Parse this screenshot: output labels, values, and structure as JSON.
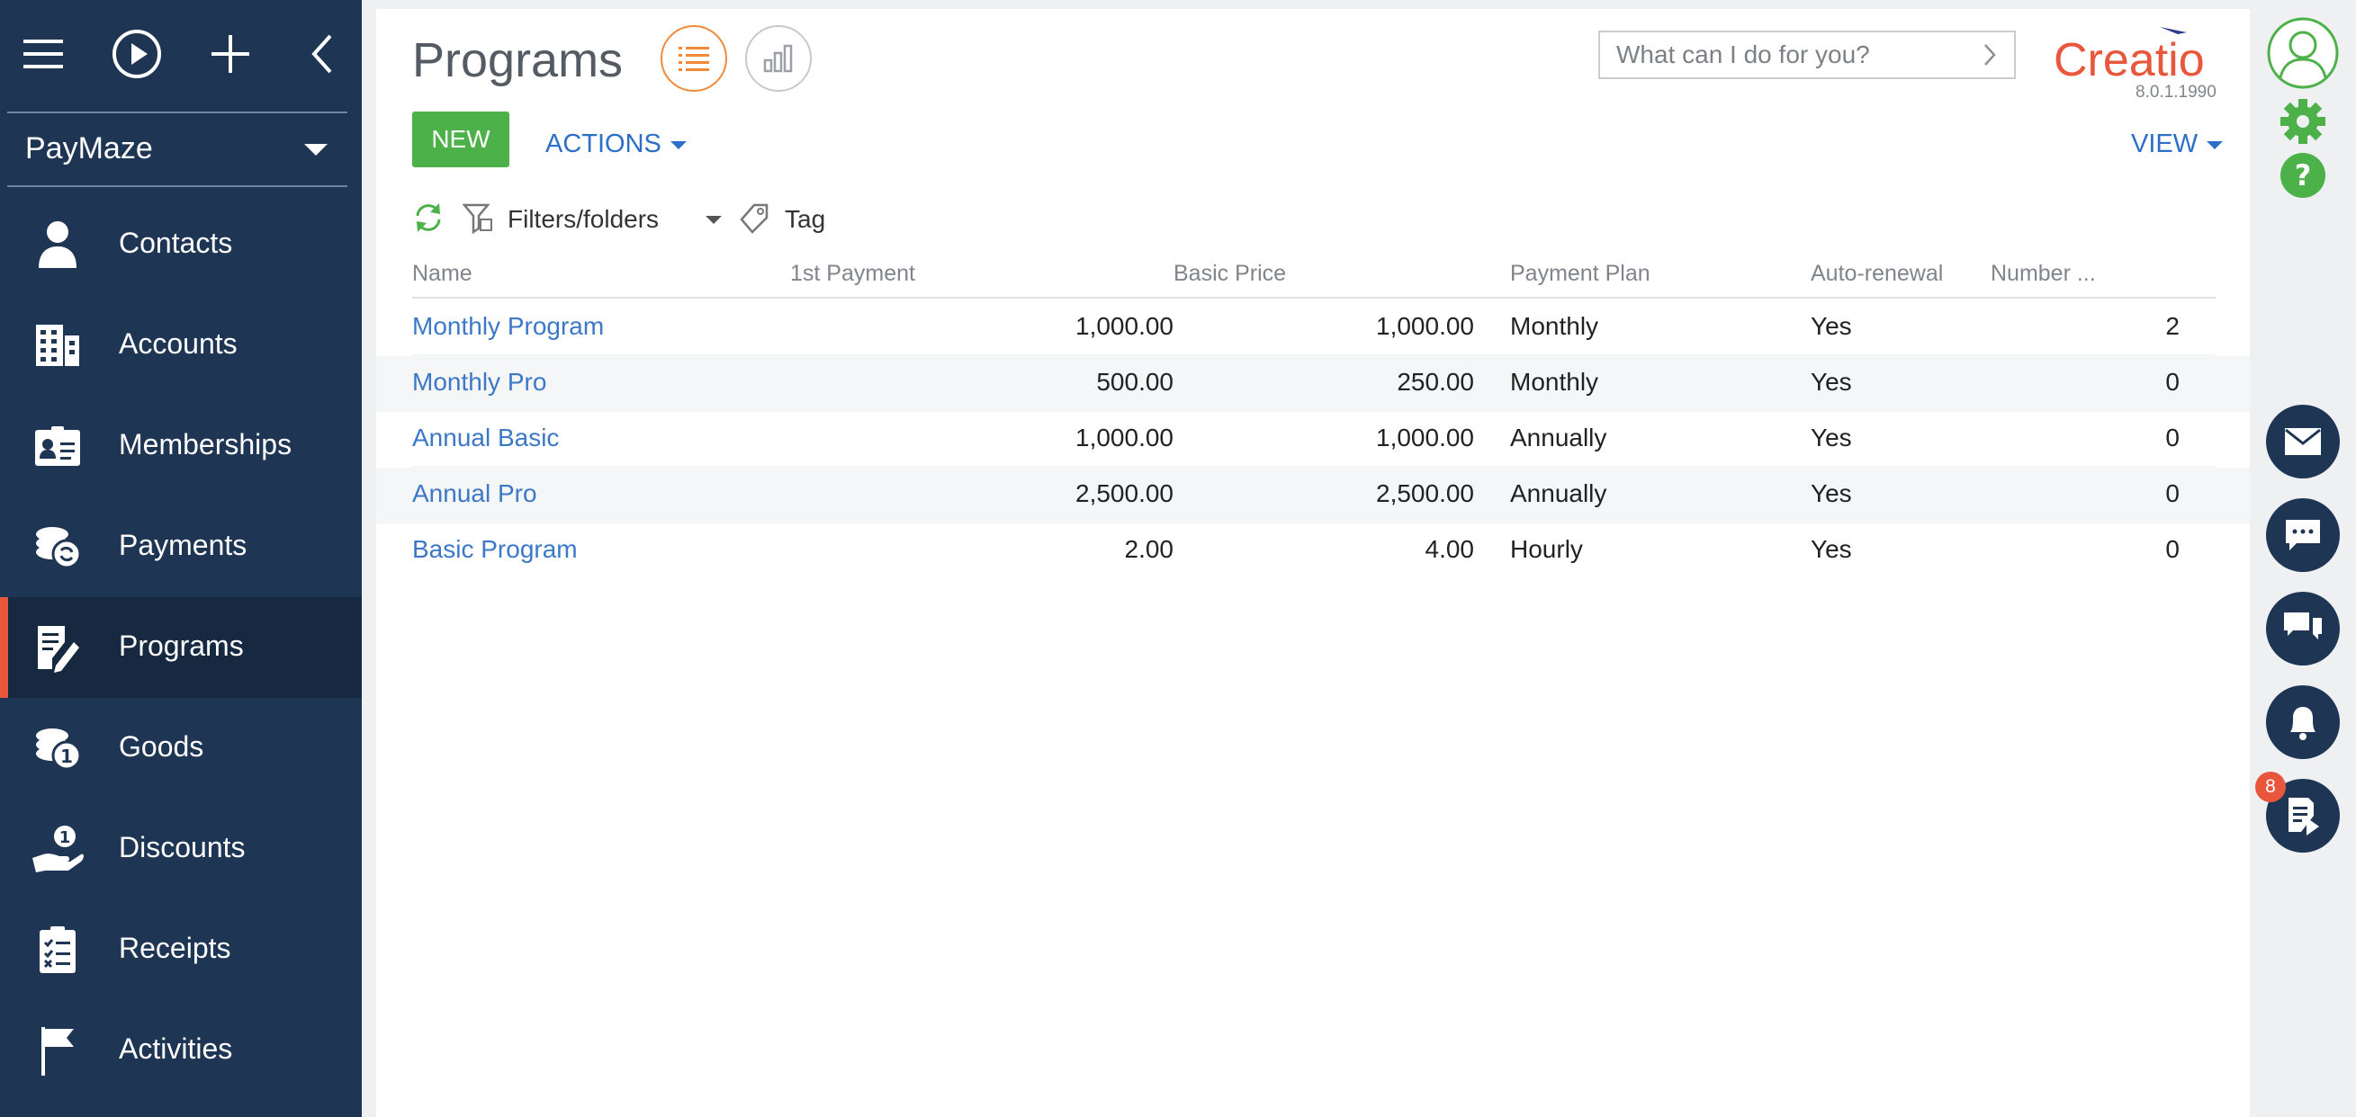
{
  "sidebar": {
    "workspace": "PayMaze",
    "items": [
      {
        "label": "Contacts",
        "icon": "person-icon"
      },
      {
        "label": "Accounts",
        "icon": "building-icon"
      },
      {
        "label": "Memberships",
        "icon": "id-card-icon"
      },
      {
        "label": "Payments",
        "icon": "coins-icon"
      },
      {
        "label": "Programs",
        "icon": "edit-document-icon",
        "active": true
      },
      {
        "label": "Goods",
        "icon": "coins-one-icon"
      },
      {
        "label": "Discounts",
        "icon": "hand-coin-icon"
      },
      {
        "label": "Receipts",
        "icon": "checklist-icon"
      },
      {
        "label": "Activities",
        "icon": "flag-icon"
      }
    ]
  },
  "header": {
    "title": "Programs",
    "search_placeholder": "What can I do for you?",
    "logo_text": "Creatio",
    "version": "8.0.1.1990"
  },
  "toolbar": {
    "new_label": "NEW",
    "actions_label": "ACTIONS",
    "view_label": "VIEW"
  },
  "filters": {
    "filters_label": "Filters/folders",
    "tag_label": "Tag"
  },
  "table": {
    "columns": [
      "Name",
      "1st Payment",
      "Basic Price",
      "Payment Plan",
      "Auto-renewal",
      "Number ..."
    ],
    "rows": [
      {
        "name": "Monthly Program",
        "first_payment": "1,000.00",
        "basic_price": "1,000.00",
        "plan": "Monthly",
        "auto_renewal": "Yes",
        "number": "2"
      },
      {
        "name": "Monthly Pro",
        "first_payment": "500.00",
        "basic_price": "250.00",
        "plan": "Monthly",
        "auto_renewal": "Yes",
        "number": "0"
      },
      {
        "name": "Annual Basic",
        "first_payment": "1,000.00",
        "basic_price": "1,000.00",
        "plan": "Annually",
        "auto_renewal": "Yes",
        "number": "0"
      },
      {
        "name": "Annual Pro",
        "first_payment": "2,500.00",
        "basic_price": "2,500.00",
        "plan": "Annually",
        "auto_renewal": "Yes",
        "number": "0"
      },
      {
        "name": "Basic Program",
        "first_payment": "2.00",
        "basic_price": "4.00",
        "plan": "Hourly",
        "auto_renewal": "Yes",
        "number": "0"
      }
    ]
  },
  "rail": {
    "notification_count": "8"
  },
  "colors": {
    "sidebar_bg": "#1e3553",
    "accent": "#e8563b",
    "link": "#3c78c8",
    "new_button": "#4db14a"
  }
}
